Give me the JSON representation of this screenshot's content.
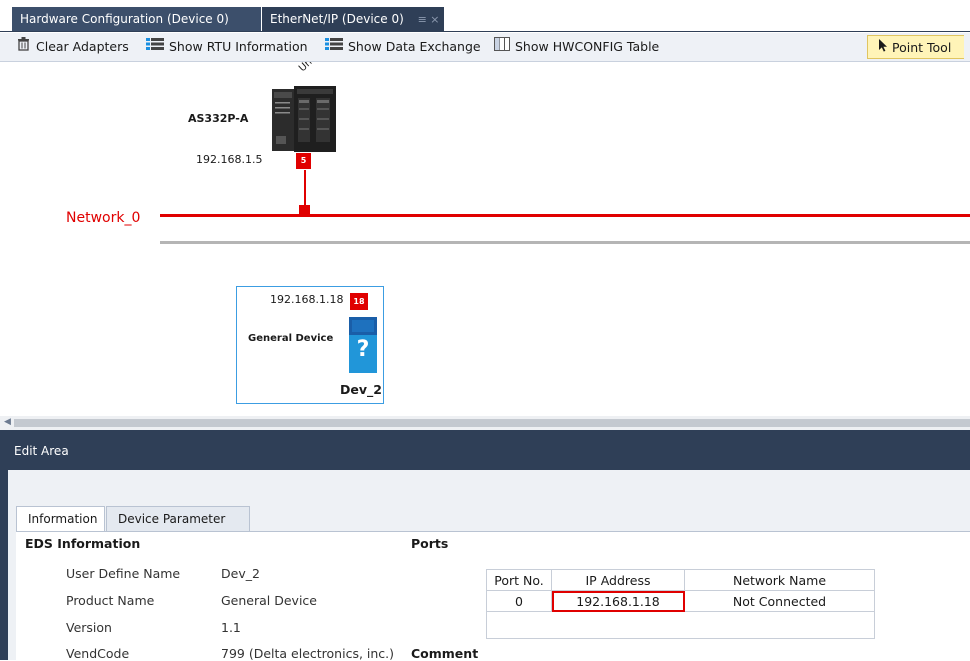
{
  "tabs": {
    "hardware": "Hardware Configuration (Device 0)",
    "ethernet": "EtherNet/IP (Device 0)",
    "ethernet_controls": "≡ ×"
  },
  "toolbar": {
    "clear_adapters": "Clear Adapters",
    "show_rtu": "Show RTU Information",
    "show_data_exchange": "Show Data Exchange",
    "show_hwconfig": "Show HWCONFIG Table",
    "point_tool": "Point Tool"
  },
  "canvas": {
    "plc": {
      "model": "AS332P-A",
      "ip": "192.168.1.5",
      "port_no": "5",
      "cut_label": "Untit"
    },
    "network": {
      "name": "Network_0"
    },
    "device": {
      "ip": "192.168.1.18",
      "port_no": "18",
      "type": "General Device",
      "name": "Dev_2",
      "icon_glyph": "?"
    }
  },
  "edit_area": {
    "title": "Edit Area",
    "tabs": [
      "Information",
      "Device Parameter"
    ],
    "eds_section": "EDS Information",
    "ports_section": "Ports",
    "comment_section": "Comment",
    "fields": [
      {
        "label": "User Define Name",
        "value": "Dev_2"
      },
      {
        "label": "Product Name",
        "value": "General Device"
      },
      {
        "label": "Version",
        "value": "1.1"
      },
      {
        "label": "VendCode",
        "value": "799 (Delta electronics, inc.)"
      }
    ],
    "ports_table": {
      "headers": [
        "Port No.",
        "IP Address",
        "Network Name"
      ],
      "rows": [
        [
          "0",
          "192.168.1.18",
          "Not Connected"
        ]
      ]
    }
  },
  "colors": {
    "accent": "#e00000",
    "dark_blue": "#2f3f57",
    "device_blue": "#29a3e6"
  }
}
